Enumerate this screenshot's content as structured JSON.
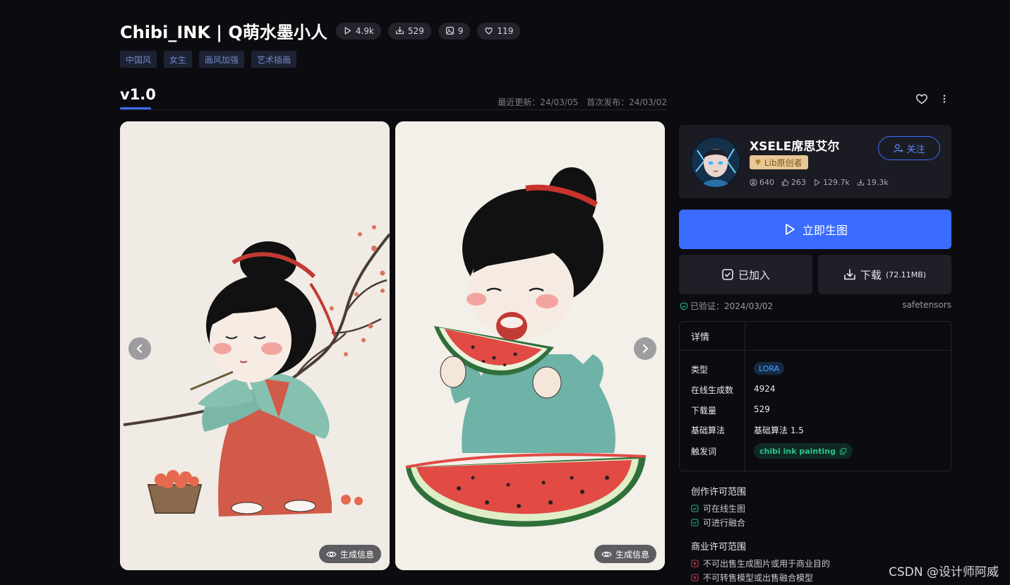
{
  "model": {
    "title": "Chibi_INK | Q萌水墨小人",
    "stats": [
      {
        "icon": "play-icon",
        "value": "4.9k"
      },
      {
        "icon": "download-icon",
        "value": "529"
      },
      {
        "icon": "image-icon",
        "value": "9"
      },
      {
        "icon": "heart-icon",
        "value": "119"
      }
    ],
    "tags": [
      "中国风",
      "女生",
      "画风加强",
      "艺术插画"
    ]
  },
  "version": {
    "label": "v1.0",
    "updated": "最近更新：24/03/05",
    "published": "首次发布：24/03/02"
  },
  "gallery": {
    "gen_info_label": "生成信息"
  },
  "creator": {
    "name": "XSELE席思艾尔",
    "badge": "Lib原创者",
    "follow_label": "关注",
    "stats": [
      {
        "icon": "user-icon",
        "value": "640"
      },
      {
        "icon": "download-icon",
        "value": "263"
      },
      {
        "icon": "play-icon",
        "value": "129.7k"
      },
      {
        "icon": "download-icon",
        "value": "19.3k"
      }
    ]
  },
  "actions": {
    "generate": "立即生图",
    "added": "已加入",
    "download": "下载",
    "download_size": "(72.11MB)"
  },
  "verify": {
    "text": "已验证：2024/03/02",
    "format": "safetensors"
  },
  "details": {
    "title": "详情",
    "rows": [
      {
        "label": "类型",
        "value": "LORA"
      },
      {
        "label": "在线生成数",
        "value": "4924"
      },
      {
        "label": "下载量",
        "value": "529"
      },
      {
        "label": "基础算法",
        "value": "基础算法 1.5"
      },
      {
        "label": "触发词",
        "value": "chibi ink painting"
      }
    ]
  },
  "license": {
    "creative_title": "创作许可范围",
    "creative_items": [
      "可在线生图",
      "可进行融合"
    ],
    "commercial_title": "商业许可范围",
    "commercial_items": [
      "不可出售生成图片或用于商业目的",
      "不可转售模型或出售融合模型"
    ]
  },
  "watermark": "CSDN @设计师阿威",
  "colors": {
    "accent": "#3b6cff",
    "allowed": "#27c48c",
    "denied": "#e0445a",
    "badge_gold": "#e9c896"
  }
}
